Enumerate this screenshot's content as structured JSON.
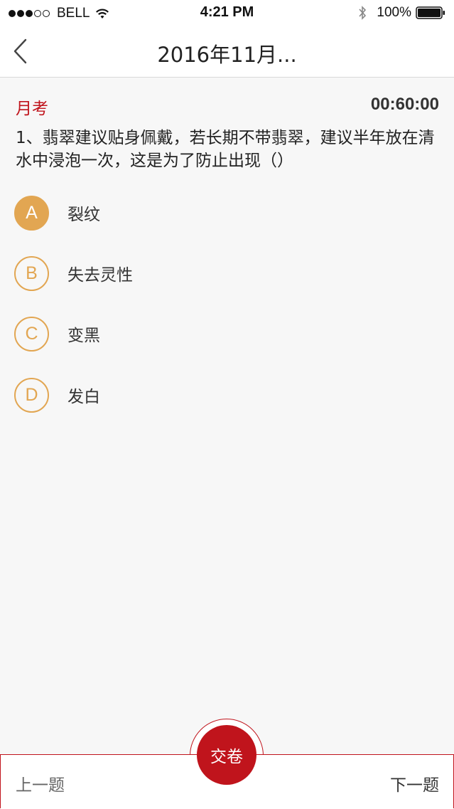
{
  "status_bar": {
    "carrier": "BELL",
    "time": "4:21 PM",
    "battery": "100%",
    "icons": [
      "signal-dots",
      "wifi-icon",
      "bluetooth-icon",
      "battery-icon"
    ]
  },
  "nav": {
    "title": "2016年11月...",
    "back_icon": "chevron-left-icon"
  },
  "exam": {
    "label": "月考",
    "timer": "00:60:00"
  },
  "question": {
    "text": "1、翡翠建议贴身佩戴，若长期不带翡翠，建议半年放在清水中浸泡一次，这是为了防止出现（）"
  },
  "options": [
    {
      "letter": "A",
      "text": "裂纹",
      "selected": true
    },
    {
      "letter": "B",
      "text": "失去灵性",
      "selected": false
    },
    {
      "letter": "C",
      "text": "变黑",
      "selected": false
    },
    {
      "letter": "D",
      "text": "发白",
      "selected": false
    }
  ],
  "bottom": {
    "prev": "上一题",
    "submit": "交卷",
    "next": "下一题"
  },
  "colors": {
    "accent_red": "#c0141c",
    "option_gold": "#e2a652"
  }
}
